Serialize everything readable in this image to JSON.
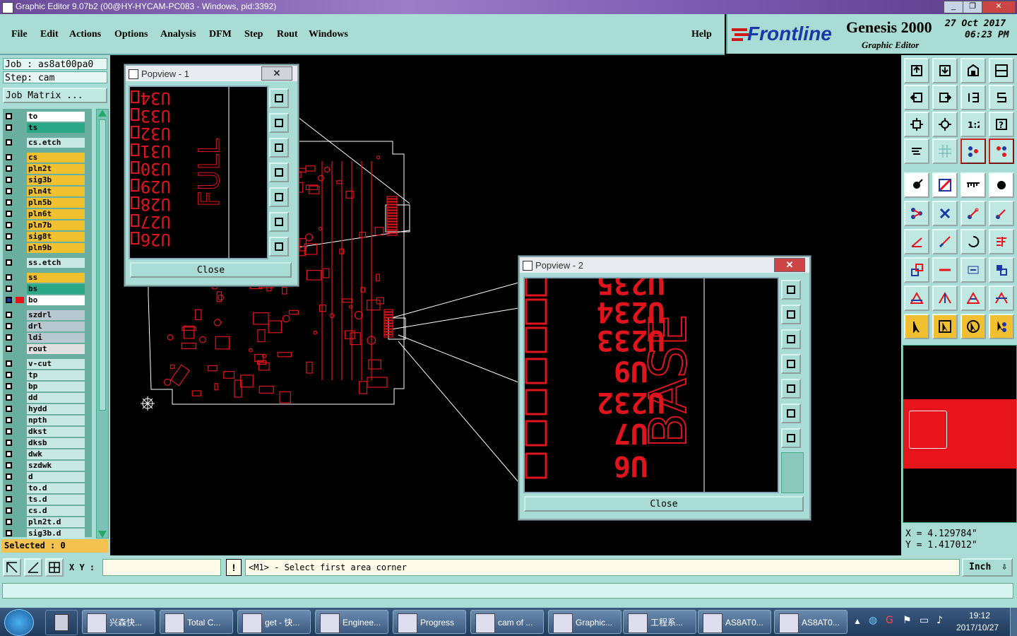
{
  "window": {
    "title": "Graphic Editor 9.07b2 (00@HY-HYCAM-PC083 - Windows, pid:3392)"
  },
  "menu": {
    "items": [
      "File",
      "Edit",
      "Actions",
      "Options",
      "Analysis",
      "DFM",
      "Step",
      "Rout",
      "Windows"
    ],
    "help": "Help"
  },
  "brand": {
    "logo": "Frontline",
    "product": "Genesis 2000",
    "sub": "Graphic Editor",
    "date": "27 Oct 2017",
    "time": "06:23 PM"
  },
  "job": {
    "job_label": "Job : as8at00pa0",
    "step_label": "Step: cam",
    "matrix_button": "Job Matrix ..."
  },
  "layers": [
    {
      "name": "to",
      "color": "#ffffff"
    },
    {
      "name": "ts",
      "color": "#2aa888"
    },
    {
      "name": "cs.etch",
      "color": "#c8e8e4"
    },
    {
      "name": "cs",
      "color": "#f0c030"
    },
    {
      "name": "pln2t",
      "color": "#f0c030"
    },
    {
      "name": "sig3b",
      "color": "#f0c030"
    },
    {
      "name": "pln4t",
      "color": "#f0c030"
    },
    {
      "name": "pln5b",
      "color": "#f0c030"
    },
    {
      "name": "pln6t",
      "color": "#f0c030"
    },
    {
      "name": "pln7b",
      "color": "#f0c030"
    },
    {
      "name": "sig8t",
      "color": "#f0c030"
    },
    {
      "name": "pln9b",
      "color": "#f0c030"
    },
    {
      "name": "ss.etch",
      "color": "#c8e8e4"
    },
    {
      "name": "ss",
      "color": "#f0c030"
    },
    {
      "name": "bs",
      "color": "#2aa888"
    },
    {
      "name": "bo",
      "color": "#ffffff"
    },
    {
      "name": "szdrl",
      "color": "#b8c8d0"
    },
    {
      "name": "drl",
      "color": "#b8c8d0"
    },
    {
      "name": "ldi",
      "color": "#b8c8d0"
    },
    {
      "name": "rout",
      "color": "#e0e0e0"
    },
    {
      "name": "v-cut",
      "color": "#c8e8e4"
    },
    {
      "name": "tp",
      "color": "#c8e8e4"
    },
    {
      "name": "bp",
      "color": "#c8e8e4"
    },
    {
      "name": "dd",
      "color": "#c8e8e4"
    },
    {
      "name": "hydd",
      "color": "#c8e8e4"
    },
    {
      "name": "npth",
      "color": "#c8e8e4"
    },
    {
      "name": "dkst",
      "color": "#c8e8e4"
    },
    {
      "name": "dksb",
      "color": "#c8e8e4"
    },
    {
      "name": "dwk",
      "color": "#c8e8e4"
    },
    {
      "name": "szdwk",
      "color": "#c8e8e4"
    },
    {
      "name": "d",
      "color": "#c8e8e4"
    },
    {
      "name": "to.d",
      "color": "#c8e8e4"
    },
    {
      "name": "ts.d",
      "color": "#c8e8e4"
    },
    {
      "name": "cs.d",
      "color": "#c8e8e4"
    },
    {
      "name": "pln2t.d",
      "color": "#c8e8e4"
    },
    {
      "name": "sig3b.d",
      "color": "#c8e8e4"
    }
  ],
  "selected": "Selected : 0",
  "popview1": {
    "title": "Popview - 1",
    "close": "Close",
    "labels": [
      "U34",
      "U33",
      "U32",
      "U31",
      "U30",
      "U29",
      "U28",
      "U27",
      "U26"
    ],
    "word": "FULL"
  },
  "popview2": {
    "title": "Popview - 2",
    "close": "Close",
    "labels": [
      "U235",
      "U234",
      "U233",
      "U9",
      "U232",
      "U7",
      "U6"
    ],
    "word": "BASE"
  },
  "coords": {
    "x": "X = 4.129784\"",
    "y": "Y = 1.417012\""
  },
  "cmd": {
    "xy_label": "X Y :",
    "xy_value": "",
    "message": "<M1> - Select first area corner",
    "unit": "Inch"
  },
  "taskbar": {
    "items": [
      "兴森快...",
      "Total C...",
      "get - 快...",
      "Enginee...",
      "Progress",
      "cam of ...",
      "Graphic...",
      "工程系...",
      "AS8AT0...",
      "AS8AT0..."
    ],
    "time": "19:12",
    "date": "2017/10/27"
  },
  "colors": {
    "accent": "#a8dcd4",
    "trace": "#e0141c"
  }
}
